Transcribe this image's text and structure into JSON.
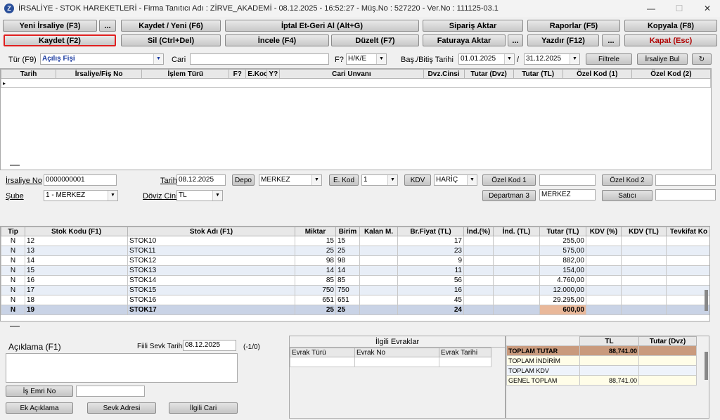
{
  "window": {
    "title": "İRSALİYE - STOK HAREKETLERİ - Firma Tanıtıcı Adı : ZİRVE_AKADEMİ - 08.12.2025 - 16:52:27 - Müş.No : 527220 - Ver.No : 111125-03.1",
    "icon_letter": "Z",
    "minimize": "—",
    "maximize": "☐",
    "close": "✕"
  },
  "toolbar": {
    "yeni_irsaliye": "Yeni İrsaliye (F3)",
    "more1": "...",
    "kaydet_yeni": "Kaydet / Yeni (F6)",
    "iptal": "İptal Et-Geri Al (Alt+G)",
    "siparis_aktar": "Sipariş Aktar",
    "raporlar": "Raporlar (F5)",
    "kopyala": "Kopyala (F8)",
    "kaydet": "Kaydet (F2)",
    "sil": "Sil (Ctrl+Del)",
    "incele": "İncele (F4)",
    "duzelt": "Düzelt (F7)",
    "faturaya_aktar": "Faturaya Aktar",
    "more2": "...",
    "yazdir": "Yazdır (F12)",
    "more3": "...",
    "kapat": "Kapat (Esc)",
    "kapat_color": "#b00000",
    "kaydet_border": "#e02020"
  },
  "filter": {
    "tur_label": "Tür (F9)",
    "tur_value": "Açılış Fişi",
    "cari_label": "Cari",
    "cari_value": "",
    "f_label": "F?",
    "f_value": "H/K/E",
    "tarih_label": "Baş./Bitiş Tarihi",
    "start_date": "01.01.2025",
    "sep": "/",
    "end_date": "31.12.2025",
    "filtrele": "Filtrele",
    "irsaliye_bul": "İrsaliye Bul",
    "refresh_icon": "↻"
  },
  "list": {
    "columns": [
      "Tarih",
      "İrsaliye/Fiş No",
      "İşlem Türü",
      "F?",
      "E.Kod",
      "Y?",
      "Cari Unvanı",
      "Dvz.Cinsi",
      "Tutar (Dvz)",
      "Tutar (TL)",
      "Özel Kod (1)",
      "Özel Kod (2)"
    ],
    "row_marker": "▸"
  },
  "header_form": {
    "irsaliye_no_label": "İrsaliye No",
    "irsaliye_no": "0000000001",
    "sube_label": "Şube",
    "sube_value": "1 - MERKEZ",
    "tarih_label": "Tarih",
    "tarih_value": "08.12.2025",
    "doviz_label": "Döviz Cinsi",
    "doviz_value": "TL",
    "depo_button": "Depo",
    "depo_value": "MERKEZ",
    "ekod_button": "E. Kod",
    "ekod_value": "1",
    "kdv_button": "KDV",
    "kdv_value": "HARİÇ",
    "ozel_kod1_button": "Özel Kod 1",
    "ozel_kod1_value": "",
    "ozel_kod2_button": "Özel Kod 2",
    "ozel_kod2_value": "",
    "departman_button": "Departman 3",
    "departman_value": "MERKEZ",
    "satici_button": "Satıcı",
    "satici_value": ""
  },
  "lines": {
    "columns": [
      "Tip",
      "Stok Kodu (F1)",
      "Stok Adı (F1)",
      "Miktar",
      "Birim",
      "Kalan M.",
      "Br.Fiyat (TL)",
      "İnd.(%)",
      "İnd. (TL)",
      "Tutar (TL)",
      "KDV (%)",
      "KDV (TL)",
      "Tevkifat Ko"
    ],
    "rows": [
      {
        "tip": "N",
        "kod": "12",
        "ad": "STOK10",
        "miktar": "15",
        "birim": "15",
        "kalan": "",
        "fiyat": "17",
        "ind_p": "",
        "ind_tl": "",
        "tutar": "255,00"
      },
      {
        "tip": "N",
        "kod": "13",
        "ad": "STOK11",
        "miktar": "25",
        "birim": "25",
        "kalan": "",
        "fiyat": "23",
        "ind_p": "",
        "ind_tl": "",
        "tutar": "575,00"
      },
      {
        "tip": "N",
        "kod": "14",
        "ad": "STOK12",
        "miktar": "98",
        "birim": "98",
        "kalan": "",
        "fiyat": "9",
        "ind_p": "",
        "ind_tl": "",
        "tutar": "882,00"
      },
      {
        "tip": "N",
        "kod": "15",
        "ad": "STOK13",
        "miktar": "14",
        "birim": "14",
        "kalan": "",
        "fiyat": "11",
        "ind_p": "",
        "ind_tl": "",
        "tutar": "154,00"
      },
      {
        "tip": "N",
        "kod": "16",
        "ad": "STOK14",
        "miktar": "85",
        "birim": "85",
        "kalan": "",
        "fiyat": "56",
        "ind_p": "",
        "ind_tl": "",
        "tutar": "4.760,00"
      },
      {
        "tip": "N",
        "kod": "17",
        "ad": "STOK15",
        "miktar": "750",
        "birim": "750",
        "kalan": "",
        "fiyat": "16",
        "ind_p": "",
        "ind_tl": "",
        "tutar": "12.000,00"
      },
      {
        "tip": "N",
        "kod": "18",
        "ad": "STOK16",
        "miktar": "651",
        "birim": "651",
        "kalan": "",
        "fiyat": "45",
        "ind_p": "",
        "ind_tl": "",
        "tutar": "29.295,00"
      },
      {
        "tip": "N",
        "kod": "19",
        "ad": "STOK17",
        "miktar": "25",
        "birim": "25",
        "kalan": "",
        "fiyat": "24",
        "ind_p": "",
        "ind_tl": "",
        "tutar": "600,00"
      }
    ],
    "row_marker": "▸"
  },
  "footer": {
    "aciklama_label": "Açıklama (F1)",
    "fiili_label": "Fiili Sevk Tarihi",
    "fiili_value": "08.12.2025",
    "counter": "(-1/0)",
    "is_emri_button": "İş Emri No",
    "is_emri_value": "",
    "ek_aciklama": "Ek Açıklama",
    "sevk_adresi": "Sevk Adresi",
    "ilgili_cari": "İlgili Cari"
  },
  "related": {
    "title": "İlgili Evraklar",
    "columns": [
      "Evrak Türü",
      "Evrak No",
      "Evrak Tarihi"
    ]
  },
  "totals": {
    "col_tl": "TL",
    "col_dvz": "Tutar (Dvz)",
    "rows": [
      {
        "label": "TOPLAM TUTAR",
        "tl": "88,741.00",
        "dvz": ""
      },
      {
        "label": "TOPLAM İNDİRİM",
        "tl": "",
        "dvz": ""
      },
      {
        "label": "TOPLAM KDV",
        "tl": "",
        "dvz": ""
      },
      {
        "label": "GENEL TOPLAM",
        "tl": "88,741.00",
        "dvz": ""
      }
    ]
  }
}
